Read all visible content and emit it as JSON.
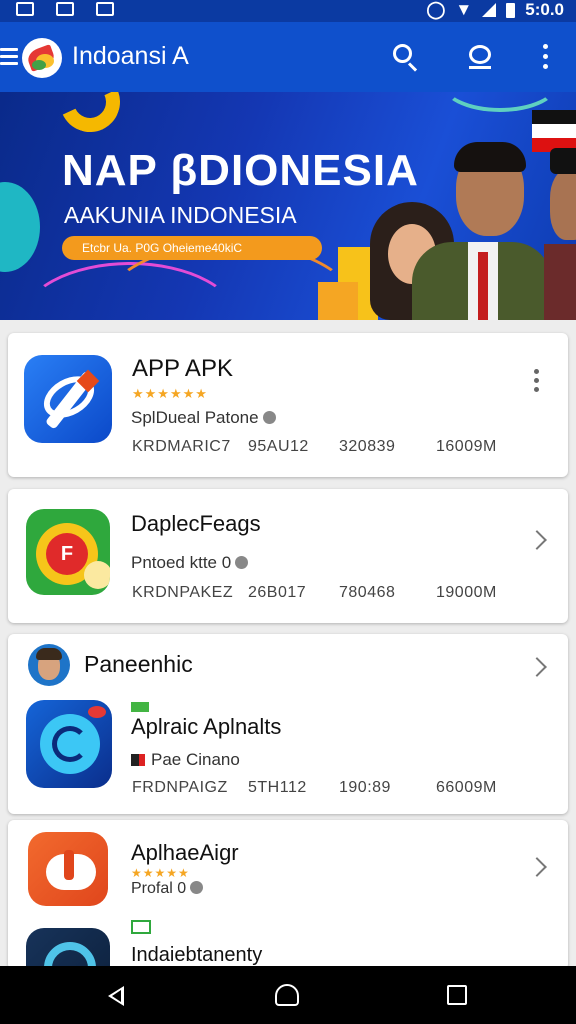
{
  "status_bar": {
    "right_text": "5:0.0"
  },
  "app_bar": {
    "title": "Indoansi A",
    "icons": [
      "menu-icon",
      "logo",
      "search-icon",
      "search-icon",
      "more-vert-icon"
    ]
  },
  "banner": {
    "headline": "NAP βDIONESIA",
    "subheadline": "AAKUNIA INDONESIA",
    "pill_text": "Etcbr Ua. P0G Oheieme40kiC"
  },
  "apps": [
    {
      "title": "APP APK",
      "stars": "★★★★★★",
      "subtitle": "SplDueal Patone",
      "meta": [
        "KRDMARIC7",
        "95AU12",
        "320839",
        "16009M"
      ]
    },
    {
      "title": "DaplecFeags",
      "subtitle": "Pntoed ktte 0",
      "meta": [
        "KRDNPAKEZ",
        "26B017",
        "780468",
        "19000M"
      ]
    },
    {
      "section_title": "Paneenhic",
      "title": "Aplraic Aplnalts",
      "subtitle": "Pae Cinano",
      "meta": [
        "FRDNPAIGZ",
        "5TH112",
        "190:89",
        "66009M"
      ]
    },
    {
      "title": "AplhaeAigr",
      "stars": "★★★★★",
      "subtitle": "Profal 0",
      "next_title": "Indaiebtanenty"
    }
  ],
  "colors": {
    "status_bar": "#0b3aa2",
    "app_bar": "#0f50cc",
    "star": "#f5a623",
    "background": "#ededed"
  }
}
